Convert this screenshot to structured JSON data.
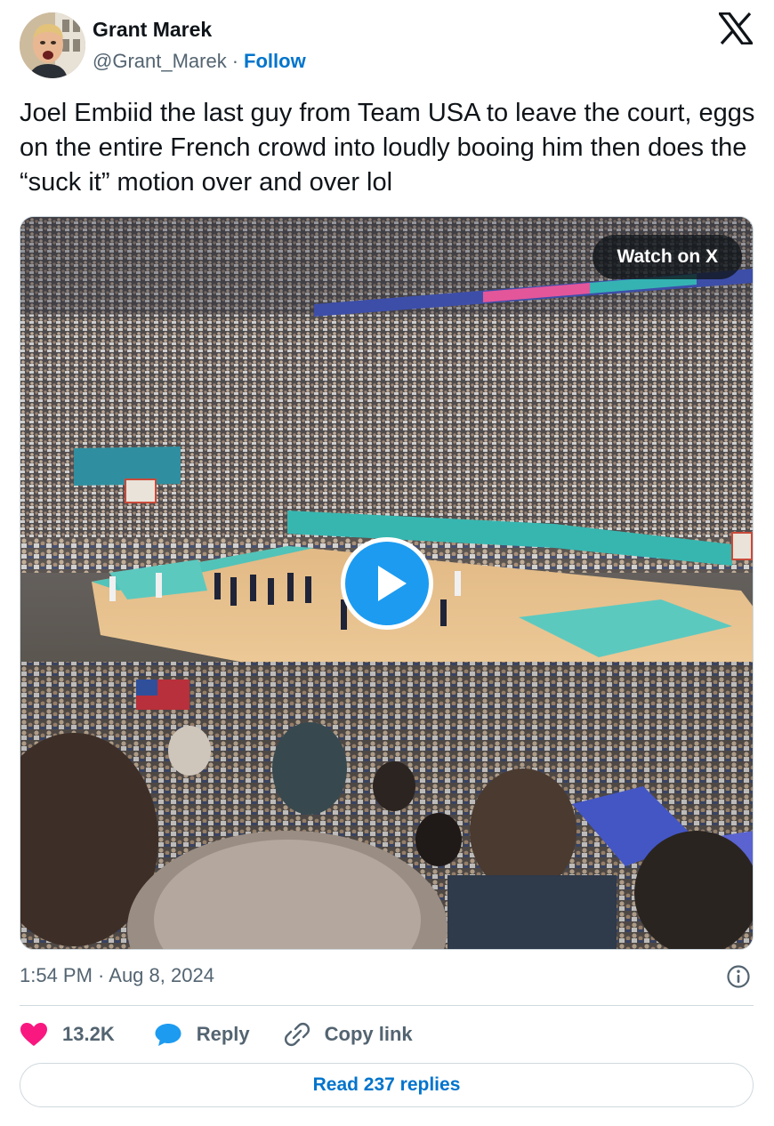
{
  "author": {
    "name": "Grant Marek",
    "handle": "@Grant_Marek",
    "separator": "·",
    "follow_label": "Follow",
    "avatar_icon": "user-avatar-photo"
  },
  "platform_logo": "x-logo-icon",
  "tweet": {
    "text": "Joel Embiid the last guy from Team USA to leave the court, eggs on the entire French crowd into loudly booing him then does the “suck it” motion over and over lol"
  },
  "media": {
    "type": "video",
    "watch_label": "Watch on X",
    "play_icon": "play-icon",
    "accent_color": "#1d9bf0"
  },
  "meta": {
    "timestamp": "1:54 PM · Aug 8, 2024",
    "info_icon": "info-icon"
  },
  "actions": {
    "like_count": "13.2K",
    "like_icon": "heart-icon",
    "like_color": "#f91880",
    "reply_label": "Reply",
    "reply_icon": "speech-bubble-icon",
    "copy_label": "Copy link",
    "copy_icon": "link-icon"
  },
  "read_replies_label": "Read 237 replies",
  "colors": {
    "text_primary": "#0f1419",
    "text_secondary": "#536471",
    "link": "#0074cc",
    "border": "#cfd9de"
  }
}
